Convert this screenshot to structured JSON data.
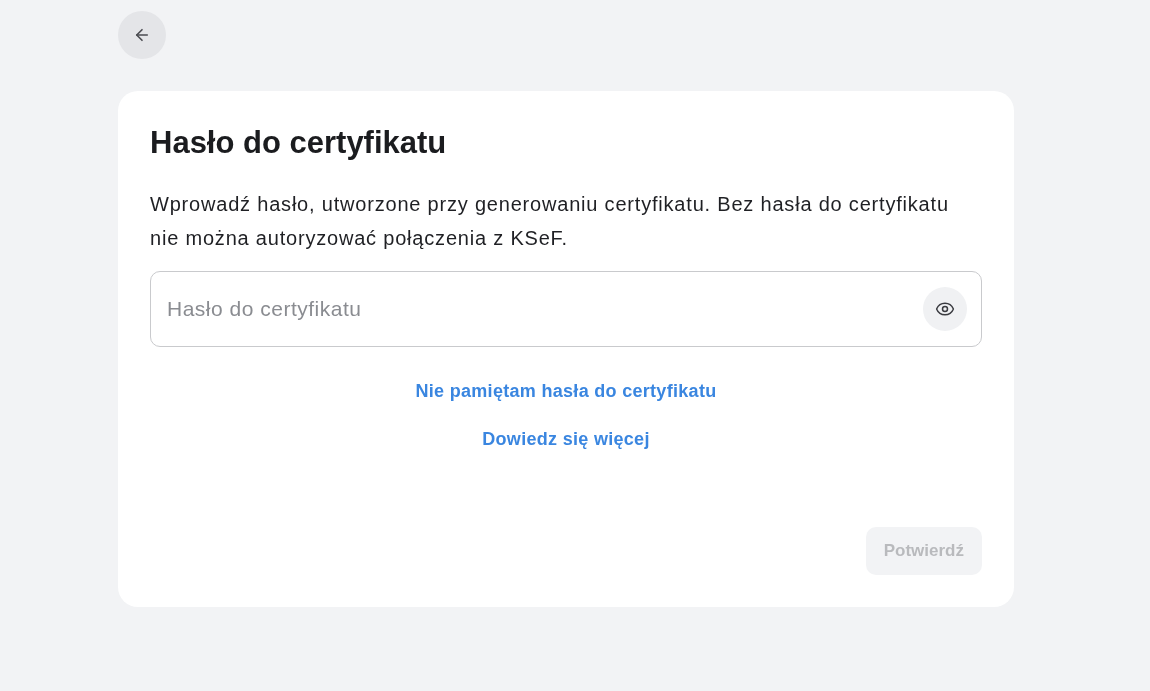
{
  "title": "Hasło do certyfikatu",
  "description": "Wprowadź hasło, utworzone przy generowaniu certyfikatu. Bez hasła do certyfikatu nie można autoryzować połączenia z KSeF.",
  "password_field": {
    "placeholder": "Hasło do certyfikatu",
    "password_visible": false
  },
  "links": [
    "Nie pamiętam hasła do certyfikatu",
    "Dowiedz się więcej"
  ],
  "confirm_button": {
    "label": "Potwierdź",
    "disabled": true
  }
}
